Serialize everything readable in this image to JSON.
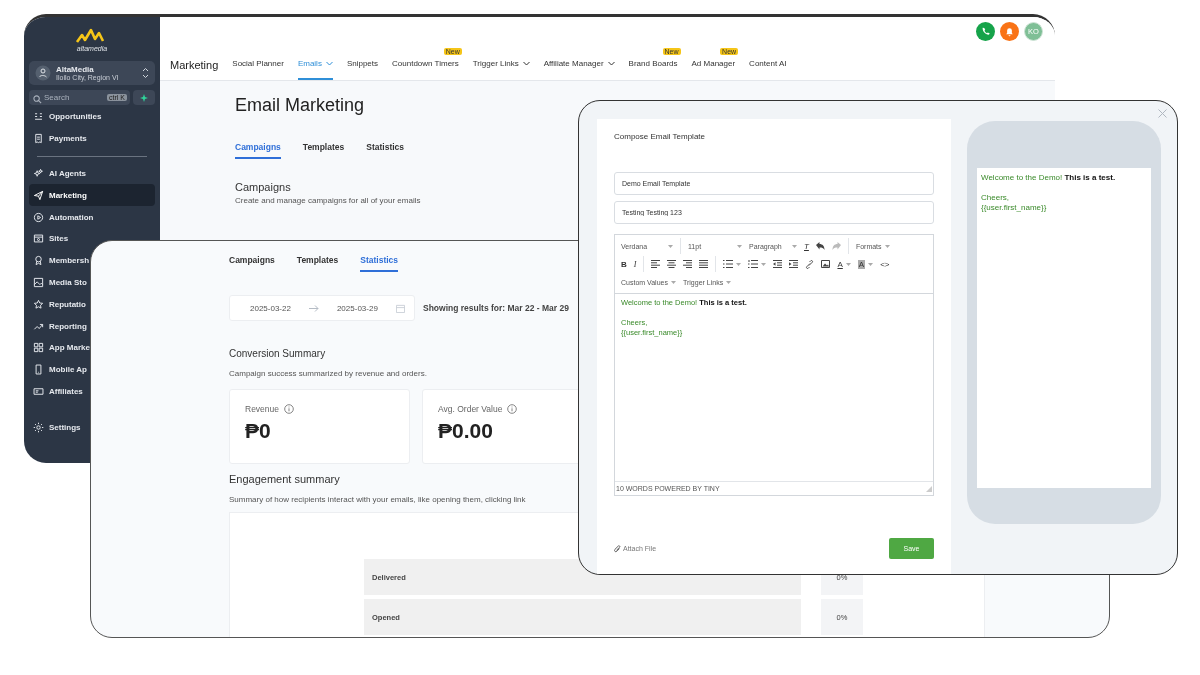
{
  "back_window": {
    "sidebar": {
      "logo_text": "altamedia",
      "account": {
        "name": "AltaMedia",
        "location": "Iloilo City, Region VI"
      },
      "search": {
        "placeholder": "Search",
        "shortcut": "ctrl K"
      },
      "sections": [
        {
          "items": [
            {
              "label": "Opportunities",
              "selected": false
            },
            {
              "label": "Payments",
              "selected": false
            }
          ]
        },
        {
          "items": [
            {
              "label": "AI Agents",
              "selected": false
            },
            {
              "label": "Marketing",
              "selected": true
            },
            {
              "label": "Automation",
              "selected": false
            },
            {
              "label": "Sites",
              "selected": false
            },
            {
              "label": "Membersh",
              "selected": false
            },
            {
              "label": "Media Sto",
              "selected": false
            },
            {
              "label": "Reputatio",
              "selected": false
            },
            {
              "label": "Reporting",
              "selected": false
            },
            {
              "label": "App Marke",
              "selected": false
            },
            {
              "label": "Mobile Ap",
              "selected": false
            },
            {
              "label": "Affiliates",
              "selected": false
            }
          ]
        }
      ],
      "footer_item": {
        "label": "Settings",
        "selected": false
      }
    },
    "header": {
      "avatar": "KO"
    },
    "top_nav": {
      "title": "Marketing",
      "items": [
        {
          "label": "Social Planner",
          "selected": false,
          "dropdown": false
        },
        {
          "label": "Emails",
          "selected": true,
          "dropdown": true
        },
        {
          "label": "Snippets",
          "selected": false,
          "dropdown": false
        },
        {
          "label": "Countdown Timers",
          "selected": false,
          "dropdown": false,
          "badge": "New"
        },
        {
          "label": "Trigger Links",
          "selected": false,
          "dropdown": true
        },
        {
          "label": "Affiliate Manager",
          "selected": false,
          "dropdown": true
        },
        {
          "label": "Brand Boards",
          "selected": false,
          "dropdown": false,
          "badge": "New"
        },
        {
          "label": "Ad Manager",
          "selected": false,
          "dropdown": false,
          "badge": "New"
        },
        {
          "label": "Content AI",
          "selected": false,
          "dropdown": false
        }
      ]
    },
    "page_title": "Email Marketing",
    "tabs": [
      {
        "label": "Campaigns",
        "selected": true
      },
      {
        "label": "Templates",
        "selected": false
      },
      {
        "label": "Statistics",
        "selected": false
      }
    ],
    "section": {
      "title": "Campaigns",
      "subtitle": "Create and manage campaigns for all of your emails"
    }
  },
  "stats_window": {
    "tabs": [
      {
        "label": "Campaigns",
        "selected": false
      },
      {
        "label": "Templates",
        "selected": false
      },
      {
        "label": "Statistics",
        "selected": true
      }
    ],
    "date_range": {
      "start": "2025-03-22",
      "end": "2025-03-29"
    },
    "results_text": "Showing results for: Mar 22 - Mar 29",
    "conversion": {
      "title": "Conversion Summary",
      "subtitle": "Campaign success summarized by revenue and orders.",
      "cards": [
        {
          "label": "Revenue",
          "value": "₱0"
        },
        {
          "label": "Avg. Order Value",
          "value": "₱0.00"
        }
      ]
    },
    "engagement": {
      "title": "Engagement summary",
      "subtitle": "Summary of how recipients interact with your emails, like opening them, clicking link",
      "rows": [
        {
          "label": "Delivered",
          "value": "0%"
        },
        {
          "label": "Opened",
          "value": "0%"
        }
      ]
    }
  },
  "compose_window": {
    "title": "Compose Email Template",
    "fields": [
      {
        "value": "Demo Email Template"
      },
      {
        "value": "Testing Testing 123"
      }
    ],
    "toolbar": {
      "font": "Verdana",
      "size": "11pt",
      "block": "Paragraph",
      "clear": "T",
      "formats": "Formats",
      "bold": "B",
      "italic": "I",
      "text_color": "A",
      "highlight": "A",
      "code": "<>",
      "custom_values": "Custom Values",
      "trigger_links": "Trigger Links"
    },
    "body": [
      "Welcome to the Demo! **This is a test.**",
      "Cheers,",
      "{{user.first_name}}"
    ],
    "status": "10 WORDS POWERED BY TINY",
    "attach": "Attach File",
    "save": "Save",
    "preview": [
      "Welcome to the Demo! **This is a test.**",
      "Cheers,",
      "{{user.first_name}}"
    ]
  }
}
